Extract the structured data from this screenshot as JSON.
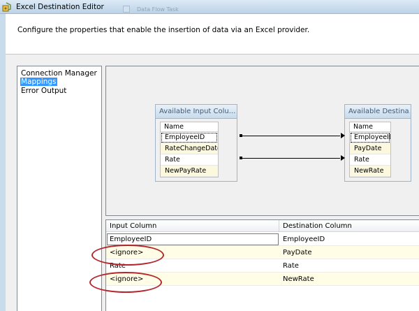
{
  "window": {
    "title": "Excel Destination Editor",
    "background_title": "Data Flow Task"
  },
  "description": "Configure the properties that enable the insertion of data via an Excel provider.",
  "nav": {
    "items": [
      {
        "label": "Connection Manager",
        "selected": false
      },
      {
        "label": "Mappings",
        "selected": true
      },
      {
        "label": "Error Output",
        "selected": false
      }
    ]
  },
  "mapping": {
    "input_table": {
      "title": "Available Input Colu...",
      "column_header": "Name",
      "columns": [
        "EmployeeID",
        "RateChangeDate",
        "Rate",
        "NewPayRate"
      ]
    },
    "destination_table": {
      "title": "Available Destina...",
      "column_header": "Name",
      "columns": [
        "EmployeeID",
        "PayDate",
        "Rate",
        "NewRate"
      ]
    }
  },
  "grid": {
    "headers": {
      "input": "Input Column",
      "destination": "Destination Column"
    },
    "rows": [
      {
        "input": "EmployeeID",
        "destination": "EmployeeID"
      },
      {
        "input": "<ignore>",
        "destination": "PayDate"
      },
      {
        "input": "Rate",
        "destination": "Rate"
      },
      {
        "input": "<ignore>",
        "destination": "NewRate"
      }
    ]
  },
  "colors": {
    "selection": "#3399ff",
    "annotation_ellipse": "#b3262c",
    "alt_row": "#fffde6"
  },
  "icons": {
    "app": "excel-destination-icon"
  }
}
